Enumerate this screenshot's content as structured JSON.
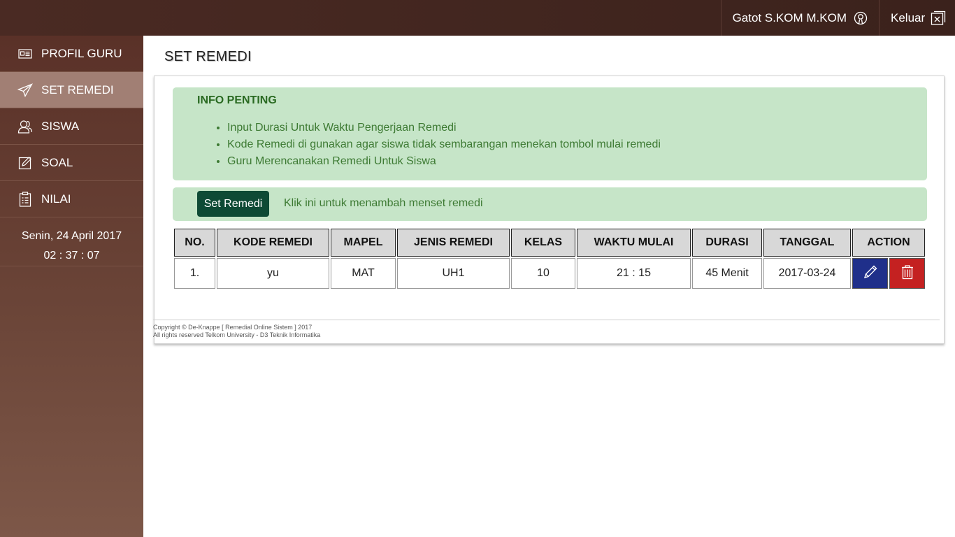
{
  "topbar": {
    "user_name": "Gatot S.KOM M.KOM",
    "user_icon": "user-circle-icon",
    "logout_label": "Keluar",
    "logout_icon": "exit-box-icon"
  },
  "sidebar": {
    "items": [
      {
        "label": "PROFIL GURU",
        "icon": "id-card-icon"
      },
      {
        "label": "SET REMEDI",
        "icon": "paper-plane-icon",
        "active": true
      },
      {
        "label": "SISWA",
        "icon": "users-icon"
      },
      {
        "label": "SOAL",
        "icon": "edit-icon"
      },
      {
        "label": "NILAI",
        "icon": "clipboard-icon"
      }
    ],
    "date": "Senin, 24 April 2017",
    "time": "02 : 37 : 07"
  },
  "main": {
    "title": "SET REMEDI",
    "info": {
      "title": "INFO PENTING",
      "points": [
        "Input Durasi Untuk Waktu Pengerjaan Remedi",
        "Kode Remedi di gunakan agar siswa tidak sembarangan menekan tombol mulai remedi",
        "Guru Merencanakan Remedi Untuk Siswa"
      ]
    },
    "set_button_label": "Set Remedi",
    "set_hint": "Klik ini untuk menambah menset remedi",
    "table": {
      "headers": [
        "NO.",
        "KODE REMEDI",
        "MAPEL",
        "JENIS REMEDI",
        "KELAS",
        "WAKTU MULAI",
        "DURASI",
        "TANGGAL",
        "ACTION"
      ],
      "rows": [
        {
          "no": "1.",
          "kode": "yu",
          "mapel": "MAT",
          "jenis": "UH1",
          "kelas": "10",
          "waktu": "21 : 15",
          "durasi": "45 Menit",
          "tanggal": "2017-03-24"
        }
      ]
    }
  },
  "footer": {
    "line1": "Copyright © De-Knappe [ Remedial Online Sistem ] 2017",
    "line2": "All rights reserved Telkom University - D3 Teknik Informatika"
  },
  "colors": {
    "topbar": "#3b221c",
    "sidebar_active": "#a17f74",
    "info_bg": "#c6e5c8",
    "set_button": "#0e4a35",
    "edit_button": "#1f2f8a",
    "delete_button": "#c42121"
  }
}
